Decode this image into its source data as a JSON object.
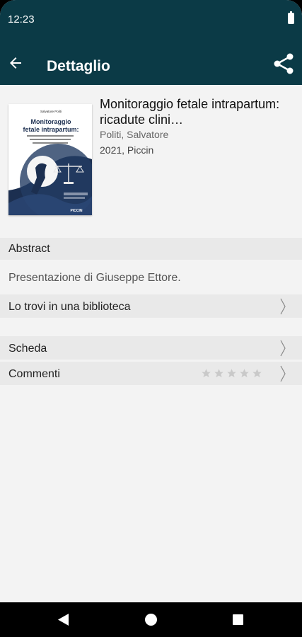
{
  "status_bar": {
    "time": "12:23"
  },
  "app_bar": {
    "title": "Dettaglio"
  },
  "book": {
    "title": "Monitoraggio fetale intrapartum: ricadute clini…",
    "author": "Politi, Salvatore",
    "publication": "2021, Piccin",
    "cover": {
      "author": "Salvatore Politi",
      "title_line1": "Monitoraggio",
      "title_line2": "fetale intrapartum:",
      "publisher": "PICCIN"
    }
  },
  "sections": {
    "abstract_label": "Abstract",
    "abstract_text": "Presentazione di Giuseppe Ettore.",
    "library_label": "Lo trovi in una biblioteca",
    "scheda_label": "Scheda",
    "comments_label": "Commenti"
  },
  "rating": {
    "value": 0,
    "max": 5
  },
  "colors": {
    "primary": "#0b3a46",
    "row_bg": "#e9e9e9",
    "page_bg": "#f3f3f3"
  },
  "icons": [
    "back-arrow-icon",
    "share-icon",
    "chevron-right-icon",
    "star-icon",
    "battery-icon"
  ]
}
